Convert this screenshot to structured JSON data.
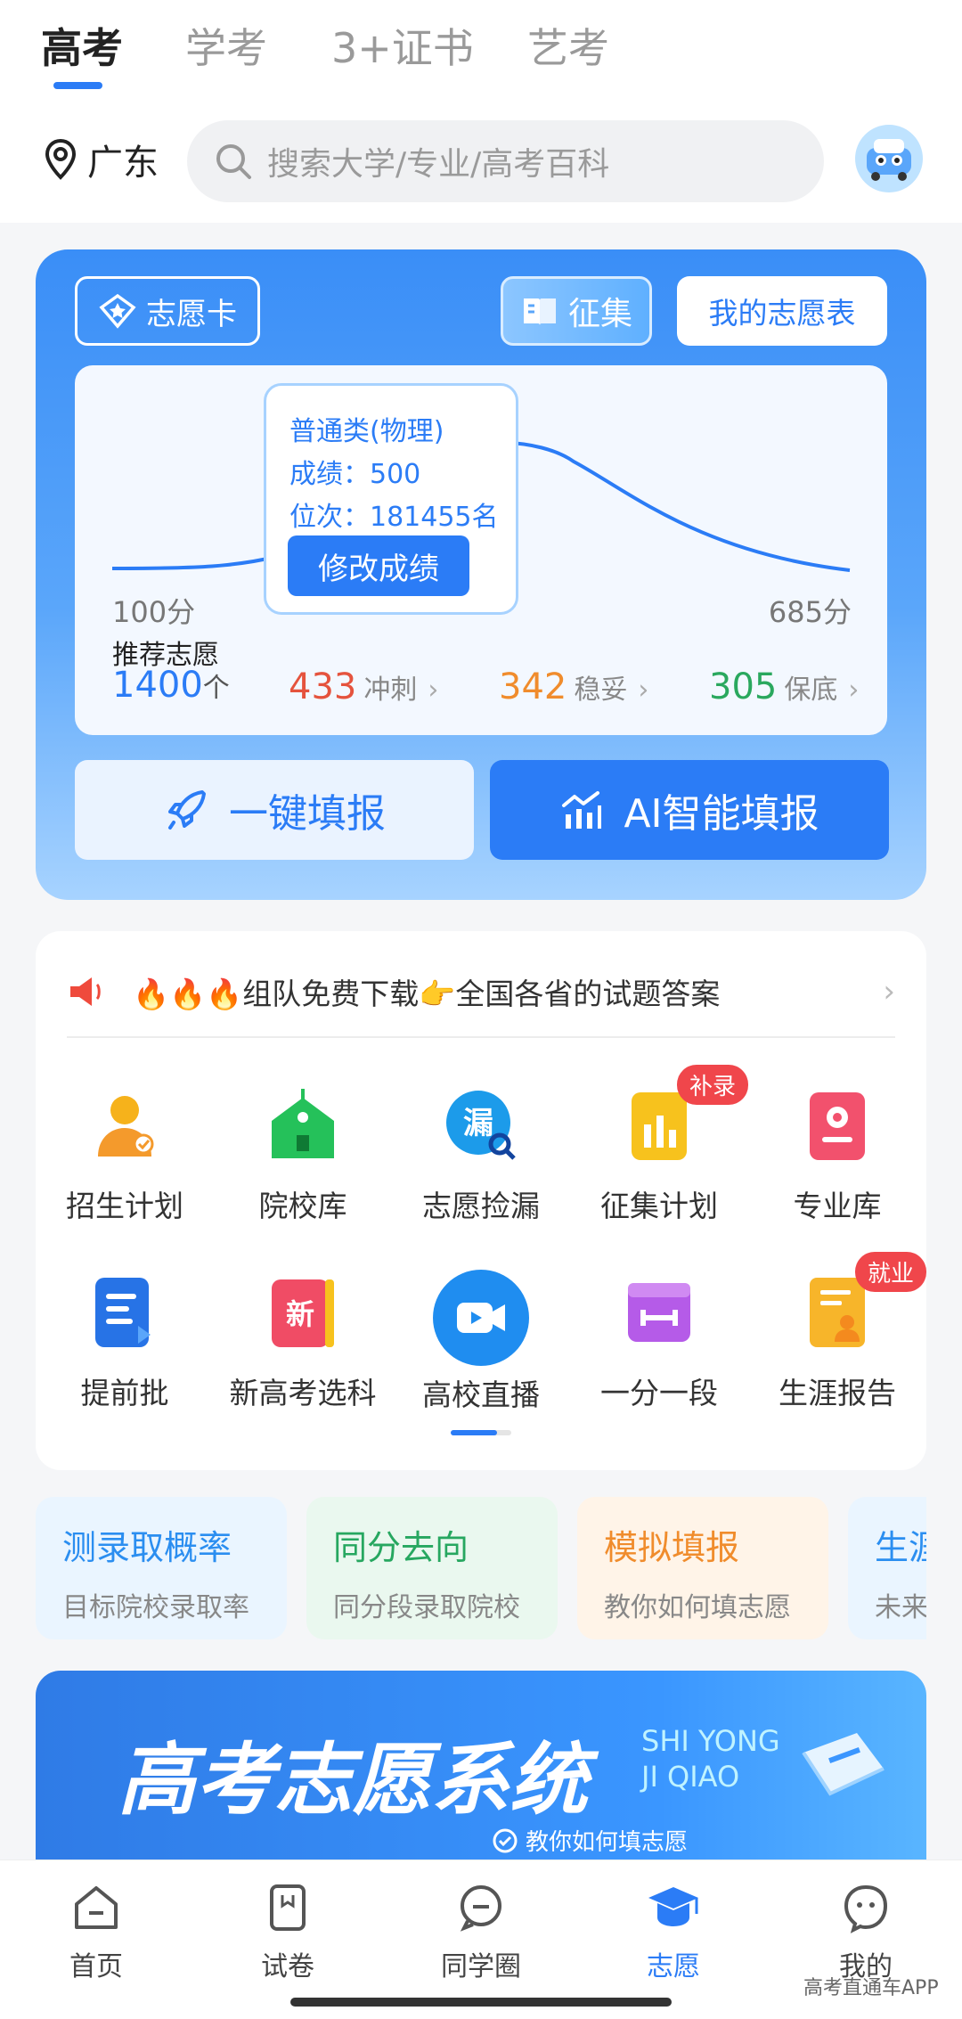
{
  "tabs": [
    {
      "label": "高考",
      "active": true
    },
    {
      "label": "学考",
      "active": false
    },
    {
      "label": "3+证书",
      "active": false
    },
    {
      "label": "艺考",
      "active": false
    }
  ],
  "location": "广东",
  "search": {
    "placeholder": "搜索大学/专业/高考百科"
  },
  "card": {
    "volunteer_card_label": "志愿卡",
    "collect_label": "征集",
    "my_table_label": "我的志愿表",
    "range_min": "100分",
    "range_max": "685分",
    "tooltip": {
      "category": "普通类(物理)",
      "score": "成绩：500",
      "rank": "位次：181455名",
      "edit_label": "修改成绩"
    },
    "recommend_label": "推荐志愿",
    "recommend_count": "1400",
    "recommend_unit": "个",
    "categories": [
      {
        "count": "433",
        "label": "冲刺",
        "color": "#e5533d"
      },
      {
        "count": "342",
        "label": "稳妥",
        "color": "#f08c2c"
      },
      {
        "count": "305",
        "label": "保底",
        "color": "#2aa85e"
      }
    ],
    "one_click_label": "一键填报",
    "ai_label": "AI智能填报"
  },
  "notice": {
    "text": "🔥🔥🔥组队免费下载👉全国各省的试题答案"
  },
  "tools": [
    {
      "label": "招生计划",
      "icon": "admission-plan-icon",
      "badge": ""
    },
    {
      "label": "院校库",
      "icon": "school-icon",
      "badge": ""
    },
    {
      "label": "志愿捡漏",
      "icon": "search-leak-icon",
      "badge": ""
    },
    {
      "label": "征集计划",
      "icon": "chart-icon",
      "badge": "补录"
    },
    {
      "label": "专业库",
      "icon": "major-icon",
      "badge": ""
    },
    {
      "label": "提前批",
      "icon": "document-icon",
      "badge": ""
    },
    {
      "label": "新高考选科",
      "icon": "new-book-icon",
      "badge": ""
    },
    {
      "label": "高校直播",
      "icon": "video-icon",
      "badge": ""
    },
    {
      "label": "一分一段",
      "icon": "ruler-icon",
      "badge": ""
    },
    {
      "label": "生涯报告",
      "icon": "report-icon",
      "badge": "就业"
    }
  ],
  "features": [
    {
      "title": "测录取概率",
      "sub": "目标院校录取率",
      "color": "#2b8ef0",
      "bg": "#eaf5ff"
    },
    {
      "title": "同分去向",
      "sub": "同分段录取院校",
      "color": "#27a760",
      "bg": "#eaf8ef"
    },
    {
      "title": "模拟填报",
      "sub": "教你如何填志愿",
      "color": "#f08c2c",
      "bg": "#fff4e8"
    },
    {
      "title": "生涯",
      "sub": "未来",
      "color": "#2b8ef0",
      "bg": "#eaf5ff"
    }
  ],
  "banner": {
    "title": "高考志愿系统",
    "sub1": "SHI YONG",
    "sub2": "JI QIAO",
    "tag": "教你如何填志愿"
  },
  "bottom_nav": [
    {
      "label": "首页",
      "active": false
    },
    {
      "label": "试卷",
      "active": false
    },
    {
      "label": "同学圈",
      "active": false
    },
    {
      "label": "志愿",
      "active": true
    },
    {
      "label": "我的",
      "active": false
    }
  ],
  "watermark": "高考直通车APP"
}
